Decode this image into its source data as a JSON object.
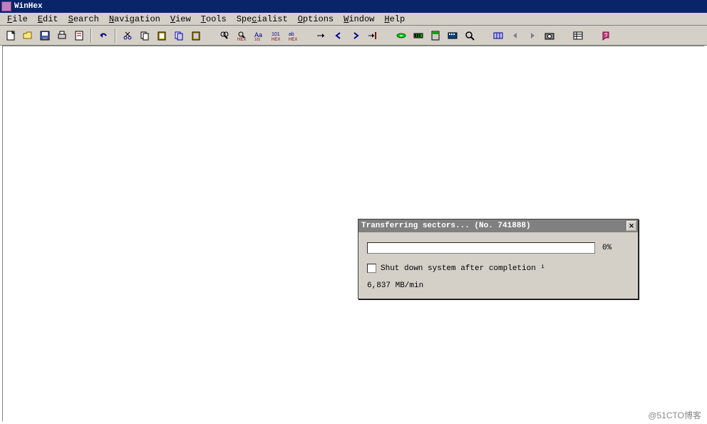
{
  "title": "WinHex",
  "menu": {
    "file": "File",
    "edit": "Edit",
    "search": "Search",
    "navigation": "Navigation",
    "view": "View",
    "tools": "Tools",
    "specialist": "Specialist",
    "options": "Options",
    "window": "Window",
    "help": "Help"
  },
  "toolbar": {
    "newfile": "new-file",
    "open": "open",
    "save": "save",
    "print": "print",
    "properties": "properties",
    "undo": "undo",
    "cut": "cut",
    "copy": "copy",
    "paste": "paste",
    "copyblock": "copy-block",
    "pasteblock": "paste-block",
    "find": "find",
    "findhex": "find-hex",
    "findtext": "find-text",
    "replace": "replace",
    "replacehex": "replace-hex",
    "gotooffset": "goto-offset",
    "back": "back",
    "forward": "forward",
    "gotomark": "goto-mark",
    "disk": "open-disk",
    "ram": "open-ram",
    "calculator": "calculator",
    "analyze": "analyze",
    "magnify": "magnify",
    "sync": "sync",
    "prev": "previous",
    "next": "next",
    "snapshot": "snapshot",
    "general": "general-options",
    "help": "help"
  },
  "dialog": {
    "title": "Transferring sectors...  (No. 741888)",
    "percent": "0%",
    "checkbox_label": "Shut down system after completion ¹",
    "rate": "6,837 MB/min"
  },
  "watermark": "@51CTO博客"
}
